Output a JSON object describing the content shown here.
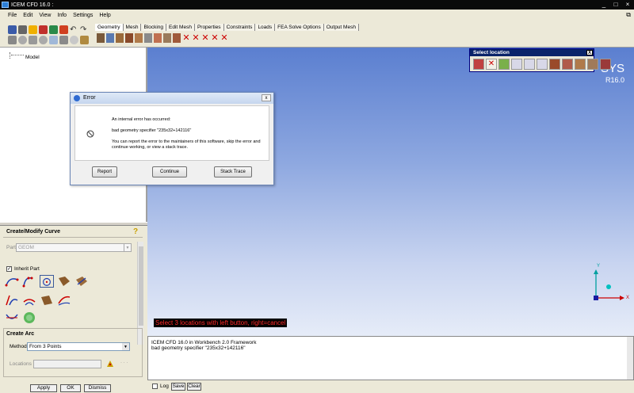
{
  "window": {
    "title": "ICEM CFD 16.0 :"
  },
  "menu": [
    "File",
    "Edit",
    "View",
    "Info",
    "Settings",
    "Help"
  ],
  "tabs": [
    "Geometry",
    "Mesh",
    "Blocking",
    "Edit Mesh",
    "Properties",
    "Constraints",
    "Loads",
    "FEA Solve Options",
    "Output Mesh"
  ],
  "tree": {
    "root": "Model"
  },
  "panel": {
    "title": "Create/Modify Curve",
    "part_label": "Part",
    "part_value": "GEOM",
    "inherit_label": "Inherit Part",
    "inherit_checked": "✓",
    "create_arc_title": "Create Arc",
    "method_label": "Method",
    "method_value": "From 3 Points",
    "locations_label": "Locations",
    "locations_dots": "· · ·",
    "apply": "Apply",
    "ok": "OK",
    "dismiss": "Dismiss"
  },
  "viewport": {
    "brand": "SYS",
    "version": "R16.0",
    "prompt": "Select 3 locations with left button, right=cancel",
    "axis_x": "X",
    "axis_y": "Y"
  },
  "select_location": {
    "title": "Select location",
    "close": "X"
  },
  "dialog": {
    "title": "Error",
    "close": "x",
    "line1": "An internal error has occurred:",
    "line2": "bad geometry specifier \"235x32+142116\"",
    "line3": "You can report the error to the maintainers of this software, skip the error and continue working, or view a stack trace.",
    "report": "Report",
    "continue": "Continue",
    "stack_trace": "Stack Trace"
  },
  "console": {
    "lines": [
      "ICEM CFD 16.0 in Workbench 2.0 Framework",
      "bad geometry specifier \"235x32+142116\""
    ],
    "log_label": "Log",
    "save": "Save",
    "clear": "Clear"
  },
  "colors": {
    "viewport_top": "#5b7fd0",
    "prompt_text": "#ff2b2b",
    "axis_y": "#00a0a0",
    "axis_x": "#cc0000"
  }
}
